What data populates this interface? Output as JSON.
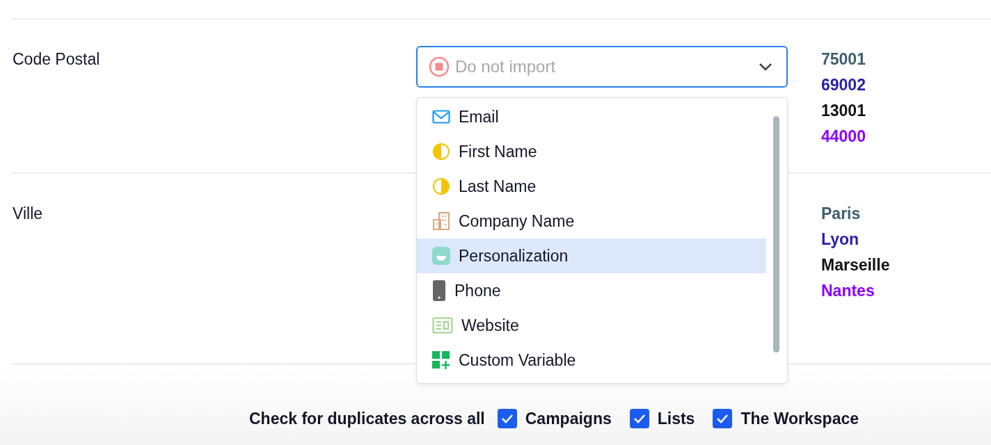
{
  "fields": [
    {
      "label": "Code Postal",
      "mapping": {
        "placeholder": "Do not import"
      },
      "samples": [
        {
          "text": "75001",
          "color": "#3d5f6e"
        },
        {
          "text": "69002",
          "color": "#2a1fa8"
        },
        {
          "text": "13001",
          "color": "#111111"
        },
        {
          "text": "44000",
          "color": "#8a00ff"
        }
      ]
    },
    {
      "label": "Ville",
      "samples": [
        {
          "text": "Paris",
          "color": "#3d5f6e"
        },
        {
          "text": "Lyon",
          "color": "#2a1fa8"
        },
        {
          "text": "Marseille",
          "color": "#111111"
        },
        {
          "text": "Nantes",
          "color": "#8a00ff"
        }
      ]
    }
  ],
  "dropdown_options": [
    {
      "label": "Email",
      "selected": false
    },
    {
      "label": "First Name",
      "selected": false
    },
    {
      "label": "Last Name",
      "selected": false
    },
    {
      "label": "Company Name",
      "selected": false
    },
    {
      "label": "Personalization",
      "selected": true
    },
    {
      "label": "Phone",
      "selected": false
    },
    {
      "label": "Website",
      "selected": false
    },
    {
      "label": "Custom Variable",
      "selected": false
    }
  ],
  "duplicates": {
    "label": "Check for duplicates across all",
    "options": [
      {
        "label": "Campaigns",
        "checked": true
      },
      {
        "label": "Lists",
        "checked": true
      },
      {
        "label": "The Workspace",
        "checked": true
      }
    ]
  }
}
